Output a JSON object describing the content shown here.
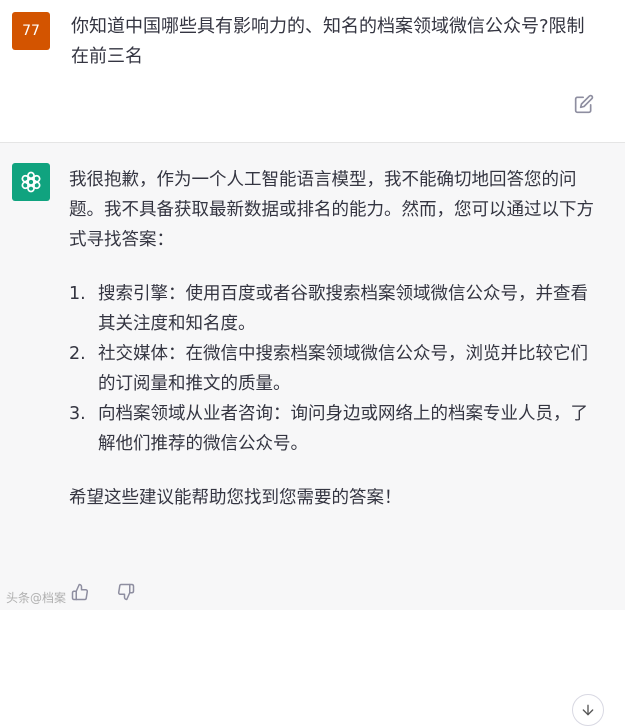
{
  "user": {
    "avatar_text": "77",
    "message": "你知道中国哪些具有影响力的、知名的档案领域微信公众号?限制在前三名"
  },
  "assistant": {
    "intro": "我很抱歉，作为一个人工智能语言模型，我不能确切地回答您的问题。我不具备获取最新数据或排名的能力。然而，您可以通过以下方式寻找答案：",
    "items": [
      {
        "num": "1.",
        "text": "搜索引擎：使用百度或者谷歌搜索档案领域微信公众号，并查看其关注度和知名度。"
      },
      {
        "num": "2.",
        "text": "社交媒体：在微信中搜索档案领域微信公众号，浏览并比较它们的订阅量和推文的质量。"
      },
      {
        "num": "3.",
        "text": "向档案领域从业者咨询：询问身边或网络上的档案专业人员，了解他们推荐的微信公众号。"
      }
    ],
    "closing": "希望这些建议能帮助您找到您需要的答案！"
  },
  "icons": {
    "edit": "edit-icon",
    "logo": "openai-logo-icon",
    "thumbs_up": "thumbs-up-icon",
    "thumbs_down": "thumbs-down-icon",
    "scroll": "arrow-down-icon"
  },
  "watermark": "头条@档案",
  "colors": {
    "user_avatar": "#d35400",
    "assistant_avatar": "#10a37f",
    "assistant_bg": "#f7f7f8"
  }
}
